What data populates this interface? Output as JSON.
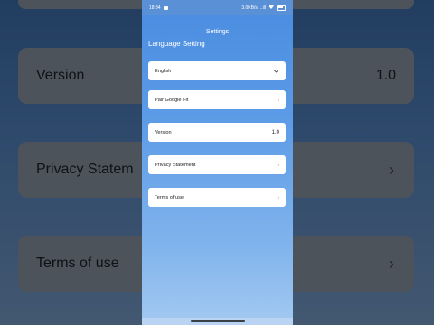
{
  "status_bar": {
    "time": "18:34",
    "speed": "3.0KB/s",
    "signal_text": "..ill",
    "wifi": "wifi-icon",
    "battery": "battery-icon"
  },
  "header": {
    "title": "Settings"
  },
  "language": {
    "section_title": "Language Setting",
    "selected": "English"
  },
  "rows": {
    "google_fit": "Pair Google Fit",
    "version_label": "Version",
    "version_value": "1.0",
    "privacy": "Privacy Statement",
    "terms": "Terms of use"
  },
  "background": {
    "version_label": "Version",
    "version_value": "1.0",
    "privacy": "Privacy Statem",
    "terms": "Terms of use"
  },
  "colors": {
    "gradient_top": "#4a8ce0",
    "gradient_bottom": "#a3c9f1",
    "card": "#ffffff"
  }
}
